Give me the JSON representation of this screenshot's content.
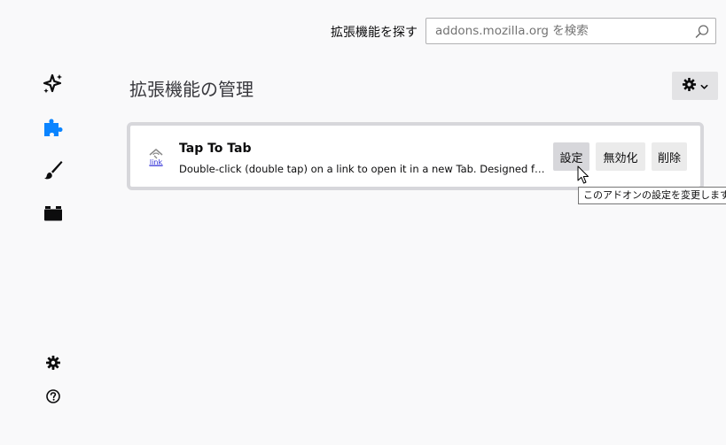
{
  "header": {
    "search_label": "拡張機能を探す",
    "search_placeholder": "addons.mozilla.org を検索",
    "search_icon": "search-icon"
  },
  "sidebar": {
    "items": [
      {
        "name": "recommendations",
        "icon": "sparkle-icon",
        "active": false
      },
      {
        "name": "extensions",
        "icon": "puzzle-icon",
        "active": true
      },
      {
        "name": "themes",
        "icon": "brush-icon",
        "active": false
      },
      {
        "name": "plugins",
        "icon": "plugin-block-icon",
        "active": false
      }
    ],
    "footer": [
      {
        "name": "addon-options",
        "icon": "gear-icon"
      },
      {
        "name": "addon-support",
        "icon": "help-icon"
      }
    ]
  },
  "main": {
    "title": "拡張機能の管理",
    "tools_icon": "gear-icon"
  },
  "addon": {
    "name": "Tap To Tab",
    "icon_text": "link",
    "description": "Double-click (double tap) on a link to open it in a new Tab. Designed for tablets and touchscreens.",
    "buttons": {
      "preferences": "設定",
      "disable": "無効化",
      "remove": "削除"
    }
  },
  "tooltip": {
    "text": "このアドオンの設定を変更します"
  },
  "colors": {
    "accent": "#0a84ff",
    "background": "#f9f9fa",
    "card_border": "#d7d7db"
  }
}
